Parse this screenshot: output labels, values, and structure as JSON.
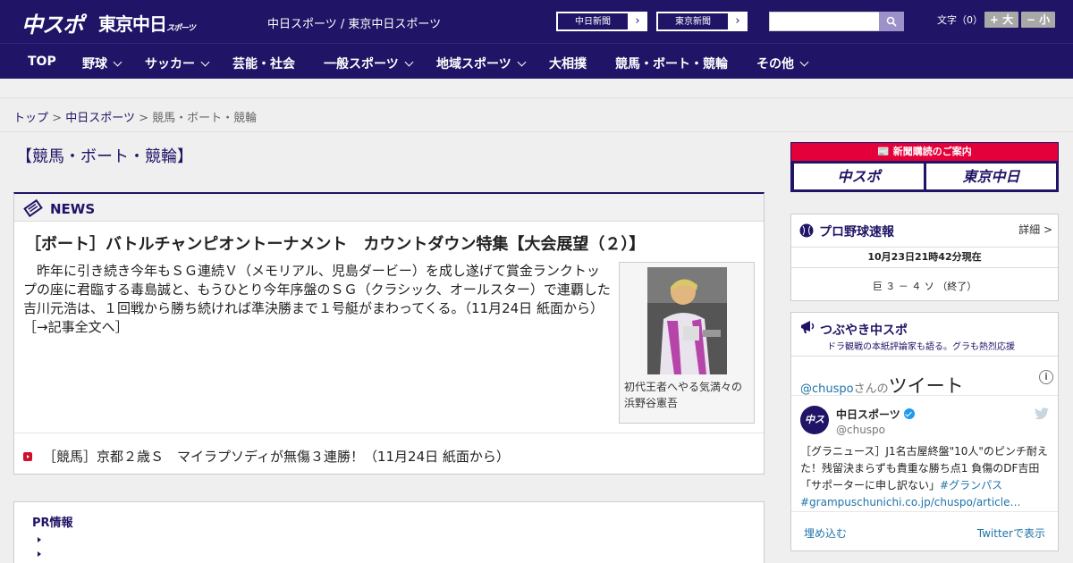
{
  "header": {
    "logo_chuspo": "中スポ",
    "logo_tokyo": "東京中日",
    "logo_tokyo_small": "スポーツ",
    "site_name": "中日スポーツ / 東京中日スポーツ",
    "ext_links": [
      {
        "label": "中日新聞"
      },
      {
        "label": "東京新聞"
      }
    ],
    "search_placeholder": "",
    "font_size_label": "文字（0）",
    "font_increase": "+ 大",
    "font_decrease": "− 小"
  },
  "nav": {
    "items": [
      {
        "label": "TOP",
        "has_dropdown": false
      },
      {
        "label": "野球",
        "has_dropdown": true
      },
      {
        "label": "サッカー",
        "has_dropdown": true
      },
      {
        "label": "芸能・社会",
        "has_dropdown": false
      },
      {
        "label": "一般スポーツ",
        "has_dropdown": true
      },
      {
        "label": "地域スポーツ",
        "has_dropdown": true
      },
      {
        "label": "大相撲",
        "has_dropdown": false
      },
      {
        "label": "競馬・ボート・競輪",
        "has_dropdown": false
      },
      {
        "label": "その他",
        "has_dropdown": true
      }
    ]
  },
  "breadcrumb": {
    "items": [
      "トップ",
      "中日スポーツ"
    ],
    "sep": ">",
    "current": "競馬・ボート・競輪"
  },
  "page_title": "【競馬・ボート・競輪】",
  "news": {
    "section_title": "NEWS",
    "headline": "［ボート］バトルチャンピオントーナメント　カウントダウン特集【大会展望（２）】",
    "summary": "昨年に引き続き今年もＳＧ連続Ｖ（メモリアル、児島ダービー）を成し遂げて賞金ランクトップの座に君臨する毒島誠と、もうひとり今年序盤のＳＧ（クラシック、オールスター）で連覇した吉川元浩は、１回戦から勝ち続ければ準決勝まで１号艇がまわってくる。（11月24日 紙面から）",
    "more_link": "［→記事全文へ］",
    "photo_caption": "初代王者へやる気満々の浜野谷憲吾",
    "items": [
      {
        "text": "［競馬］京都２歳Ｓ　マイラプソディが無傷３連勝！（11月24日 紙面から）"
      }
    ]
  },
  "pr": {
    "title": "PR情報"
  },
  "subscription": {
    "banner": "新聞購読のご案内",
    "logo_left": "中スポ",
    "logo_right": "東京中日"
  },
  "baseball": {
    "title": "プロ野球速報",
    "more": "詳細 >",
    "time": "10月23日21時42分現在",
    "game": "巨 ３ － ４ ソ （終了）"
  },
  "twitter": {
    "title": "つぶやき中スポ",
    "subtitle": "ドラ観戦の本紙評論家も語る。グラも熱烈応援",
    "handle": "@chuspo",
    "handle_suffix": "さんの",
    "tweet_label": "ツイート",
    "info": "i",
    "account_name": "中日スポーツ",
    "screen_name": "@chuspo",
    "avatar_text": "中スポ",
    "tweet_text": "［グラニュース］J1名古屋終盤\"10人\"のピンチ耐えた！残留決まらずも貴重な勝ち点1 負傷のDF吉田「サポーターに申し訳ない」",
    "hashtag": "#グランパス",
    "link": "#grampuschunichi.co.jp/chuspo/article…",
    "embed": "埋め込む",
    "view_on": "Twitterで表示"
  },
  "colors": {
    "brand": "#1f1466",
    "accent_red": "#e4003a",
    "link_blue": "#1f73a8"
  }
}
